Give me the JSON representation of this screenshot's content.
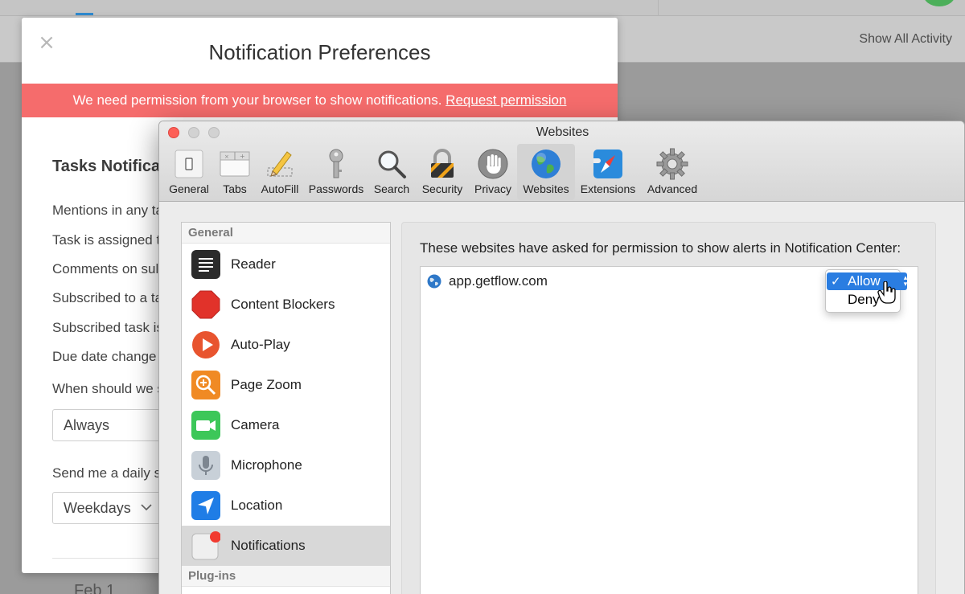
{
  "app": {
    "show_all_activity": "Show All Activity",
    "date_label": "Feb 1"
  },
  "prefs": {
    "title": "Notification Preferences",
    "banner_text": "We need permission from your browser to show notifications. ",
    "banner_link": "Request permission",
    "section_heading": "Tasks Notifica",
    "rows": [
      "Mentions in any ta",
      "Task is assigned t",
      "Comments on sul",
      "Subscribed to a ta",
      "Subscribed task is",
      "Due date change"
    ],
    "when_label": "When should we s",
    "when_value": "Always",
    "daily_label": "Send me a daily s",
    "daily_value": "Weekdays"
  },
  "safari": {
    "window_title": "Websites",
    "toolbar": [
      {
        "label": "General",
        "icon": "general-icon"
      },
      {
        "label": "Tabs",
        "icon": "tabs-icon"
      },
      {
        "label": "AutoFill",
        "icon": "autofill-icon"
      },
      {
        "label": "Passwords",
        "icon": "key-icon"
      },
      {
        "label": "Search",
        "icon": "search-icon"
      },
      {
        "label": "Security",
        "icon": "lock-icon"
      },
      {
        "label": "Privacy",
        "icon": "hand-icon"
      },
      {
        "label": "Websites",
        "icon": "globe-icon",
        "selected": true
      },
      {
        "label": "Extensions",
        "icon": "compass-icon"
      },
      {
        "label": "Advanced",
        "icon": "gear-icon"
      }
    ],
    "sidebar": {
      "general_header": "General",
      "items": [
        {
          "label": "Reader",
          "icon": "reader-icon"
        },
        {
          "label": "Content Blockers",
          "icon": "stop-sign-icon"
        },
        {
          "label": "Auto-Play",
          "icon": "play-icon"
        },
        {
          "label": "Page Zoom",
          "icon": "zoom-icon"
        },
        {
          "label": "Camera",
          "icon": "camera-icon"
        },
        {
          "label": "Microphone",
          "icon": "microphone-icon"
        },
        {
          "label": "Location",
          "icon": "location-arrow-icon"
        },
        {
          "label": "Notifications",
          "icon": "notification-icon",
          "selected": true
        }
      ],
      "plugins_header": "Plug-ins"
    },
    "panel": {
      "description": "These websites have asked for permission to show alerts in Notification Center:",
      "sites": [
        {
          "name": "app.getflow.com",
          "permission": "Allow"
        }
      ],
      "dropdown_options": [
        "Allow",
        "Deny"
      ],
      "selected_option": "Allow"
    }
  },
  "colors": {
    "banner": "#f56c6c",
    "selection_blue": "#2a7de1",
    "close_red": "#fd5f57"
  }
}
